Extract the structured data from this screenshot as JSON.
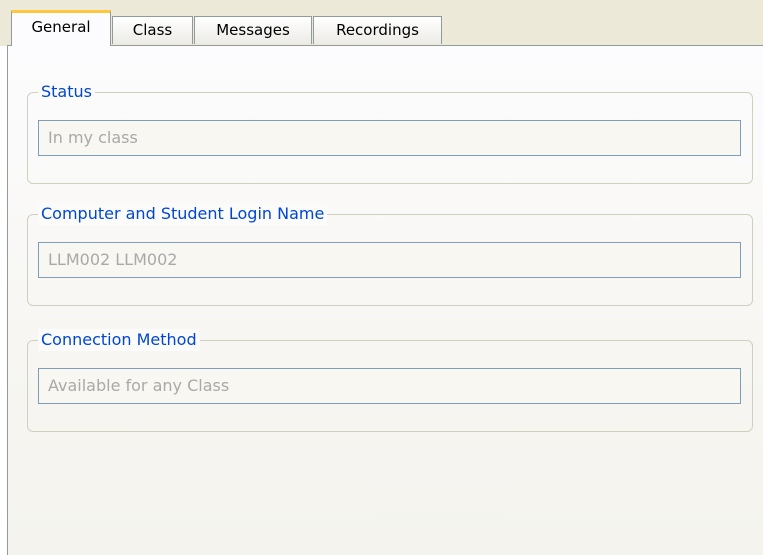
{
  "tabs": [
    {
      "label": "General",
      "active": true
    },
    {
      "label": "Class",
      "active": false
    },
    {
      "label": "Messages",
      "active": false
    },
    {
      "label": "Recordings",
      "active": false
    }
  ],
  "groups": {
    "status": {
      "legend": "Status",
      "value": "In my class"
    },
    "login": {
      "legend": "Computer and Student Login Name",
      "value": "LLM002  LLM002"
    },
    "connection": {
      "legend": "Connection Method",
      "value": "Available for any Class"
    }
  },
  "colors": {
    "legend_text": "#0046d5",
    "active_tab_accent": "#ffc83c",
    "field_border": "#7f9db9",
    "disabled_text": "#a9a9a9"
  }
}
